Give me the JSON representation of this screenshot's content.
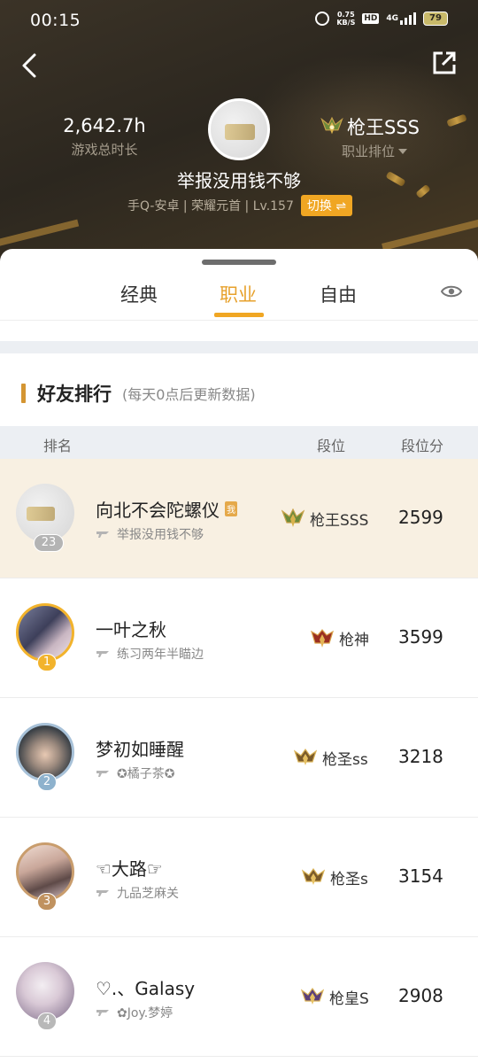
{
  "status_bar": {
    "time": "00:15",
    "speed": "0.75",
    "speed_unit": "KB/S",
    "hd": "HD",
    "network": "4G",
    "battery": "79"
  },
  "header": {
    "hours_value": "2,642.7h",
    "hours_label": "游戏总时长",
    "rank_name": "枪王SSS",
    "rank_sub": "职业排位",
    "nickname": "举报没用钱不够",
    "account": "手Q-安卓 | 荣耀元首 | Lv.157",
    "switch_label": "切换 ⇌"
  },
  "tabs": [
    {
      "label": "经典"
    },
    {
      "label": "职业",
      "active": true
    },
    {
      "label": "自由"
    }
  ],
  "section": {
    "title": "好友排行",
    "subtitle": "(每天0点后更新数据)"
  },
  "table_head": {
    "rank": "排名",
    "tier": "段位",
    "score": "段位分"
  },
  "rows": [
    {
      "badge": "23",
      "name": "向北不会陀螺仪",
      "me_tag": "我",
      "signature": "举报没用钱不够",
      "tier": "枪王SSS",
      "score": "2599"
    },
    {
      "badge": "1",
      "name": "一叶之秋",
      "signature": "练习两年半瞄边",
      "tier": "枪神",
      "score": "3599"
    },
    {
      "badge": "2",
      "name": "梦初如睡醒",
      "signature": "✪橘子茶✪",
      "tier": "枪圣ss",
      "score": "3218"
    },
    {
      "badge": "3",
      "name": "☜大路☞",
      "signature": "九品芝麻关",
      "tier": "枪圣s",
      "score": "3154"
    },
    {
      "badge": "4",
      "name": "♡.、Galasy",
      "signature": "✿Joy.梦婷",
      "tier": "枪皇S",
      "score": "2908"
    }
  ],
  "colors": {
    "accent": "#f0a623",
    "me_row": "#f8f0e2",
    "header_bg": "#2c271f"
  }
}
